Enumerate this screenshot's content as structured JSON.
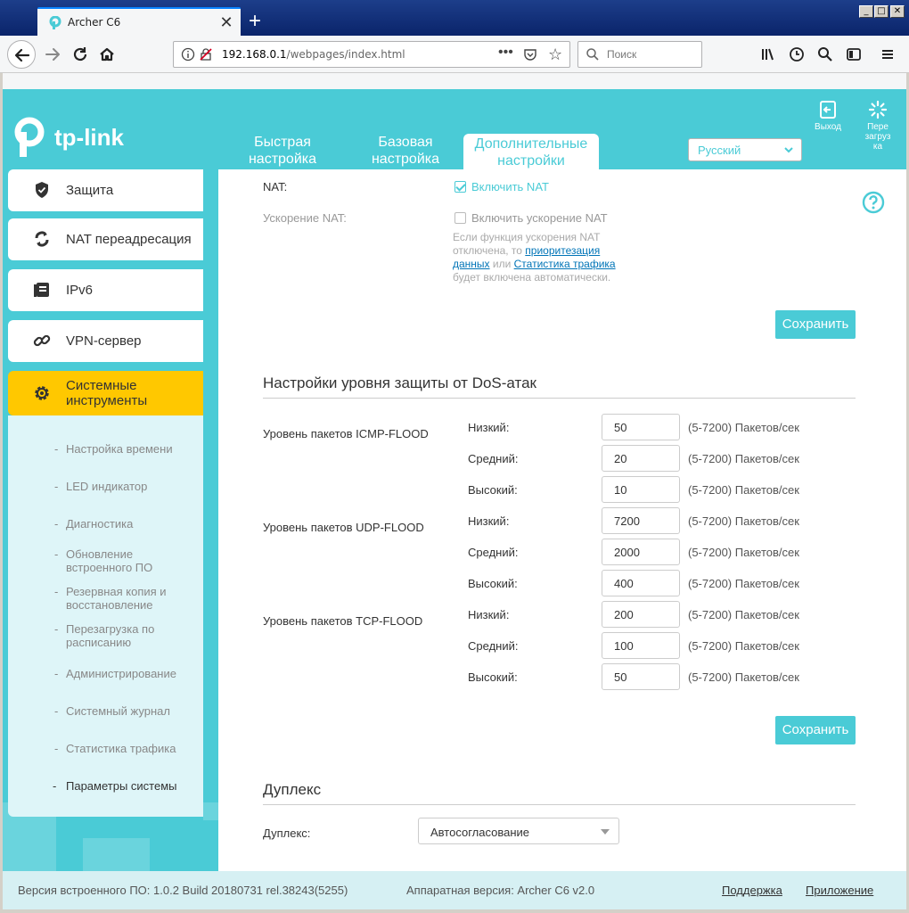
{
  "browser": {
    "tab_title": "Archer C6",
    "tab_close": "✕",
    "new_tab": "+",
    "url_host": "192.168.0.1",
    "url_path": "/webpages/index.html",
    "url_more": "•••",
    "search_placeholder": "Поиск",
    "win_min": "_",
    "win_max": "□",
    "win_close": "✕"
  },
  "header": {
    "brand": "tp-link",
    "nav": [
      {
        "label_line1": "Быстрая",
        "label_line2": "настройка"
      },
      {
        "label_line1": "Базовая",
        "label_line2": "настройка"
      },
      {
        "label_line1": "Дополнительные",
        "label_line2": "настройки"
      }
    ],
    "language": "Русский",
    "exit_label": "Выход",
    "reboot_label_1": "Пере",
    "reboot_label_2": "загруз",
    "reboot_label_3": "ка"
  },
  "sidebar": {
    "items": [
      {
        "label": "Защита",
        "icon": "shield-icon"
      },
      {
        "label": "NAT переадресация",
        "icon": "nat-icon"
      },
      {
        "label": "IPv6",
        "icon": "ipv6-icon"
      },
      {
        "label": "VPN-сервер",
        "icon": "link-icon"
      },
      {
        "label_1": "Системные",
        "label_2": "инструменты",
        "icon": "gear-icon"
      }
    ],
    "subitems": [
      {
        "label": "Настройка времени"
      },
      {
        "label": "LED индикатор"
      },
      {
        "label": "Диагностика"
      },
      {
        "label_1": "Обновление",
        "label_2": "встроенного ПО"
      },
      {
        "label_1": "Резервная копия и",
        "label_2": "восстановление"
      },
      {
        "label_1": "Перезагрузка по",
        "label_2": "расписанию"
      },
      {
        "label": "Администрирование"
      },
      {
        "label": "Системный журнал"
      },
      {
        "label": "Статистика трафика"
      },
      {
        "label": "Параметры системы"
      }
    ],
    "dash": "-"
  },
  "nat": {
    "nat_label": "NAT:",
    "nat_enable": "Включить NAT",
    "nat_enabled": true,
    "accel_label": "Ускорение NAT:",
    "accel_enable": "Включить ускорение NAT",
    "accel_enabled": false,
    "note_1": "Если функция ускорения NAT",
    "note_2": "отключена, то ",
    "note_link1a": "приоритезация",
    "note_link1b": "данных",
    "note_mid": " или ",
    "note_link2": "Статистика трафика",
    "note_3": "будет включена автоматически."
  },
  "save_label": "Сохранить",
  "dos": {
    "title": "Настройки уровня защиты от DoS-атак",
    "groups": [
      {
        "label": "Уровень пакетов ICMP-FLOOD"
      },
      {
        "label": "Уровень пакетов UDP-FLOOD"
      },
      {
        "label": "Уровень пакетов TCP-FLOOD"
      }
    ],
    "rows": [
      {
        "level": "Низкий:",
        "value": "50",
        "range": "(5-7200) Пакетов/сек"
      },
      {
        "level": "Средний:",
        "value": "20",
        "range": "(5-7200) Пакетов/сек"
      },
      {
        "level": "Высокий:",
        "value": "10",
        "range": "(5-7200) Пакетов/сек"
      },
      {
        "level": "Низкий:",
        "value": "7200",
        "range": "(5-7200) Пакетов/сек"
      },
      {
        "level": "Средний:",
        "value": "2000",
        "range": "(5-7200) Пакетов/сек"
      },
      {
        "level": "Высокий:",
        "value": "400",
        "range": "(5-7200) Пакетов/сек"
      },
      {
        "level": "Низкий:",
        "value": "200",
        "range": "(5-7200) Пакетов/сек"
      },
      {
        "level": "Средний:",
        "value": "100",
        "range": "(5-7200) Пакетов/сек"
      },
      {
        "level": "Высокий:",
        "value": "50",
        "range": "(5-7200) Пакетов/сек"
      }
    ]
  },
  "duplex": {
    "title": "Дуплекс",
    "label": "Дуплекс:",
    "value": "Автосогласование"
  },
  "footer": {
    "firmware": "Версия встроенного ПО: 1.0.2 Build 20180731 rel.38243(5255)",
    "hardware": "Аппаратная версия: Archer C6 v2.0",
    "support": "Поддержка",
    "app": "Приложение"
  },
  "colors": {
    "brand": "#4acbd6",
    "active_menu": "#ffc800"
  }
}
